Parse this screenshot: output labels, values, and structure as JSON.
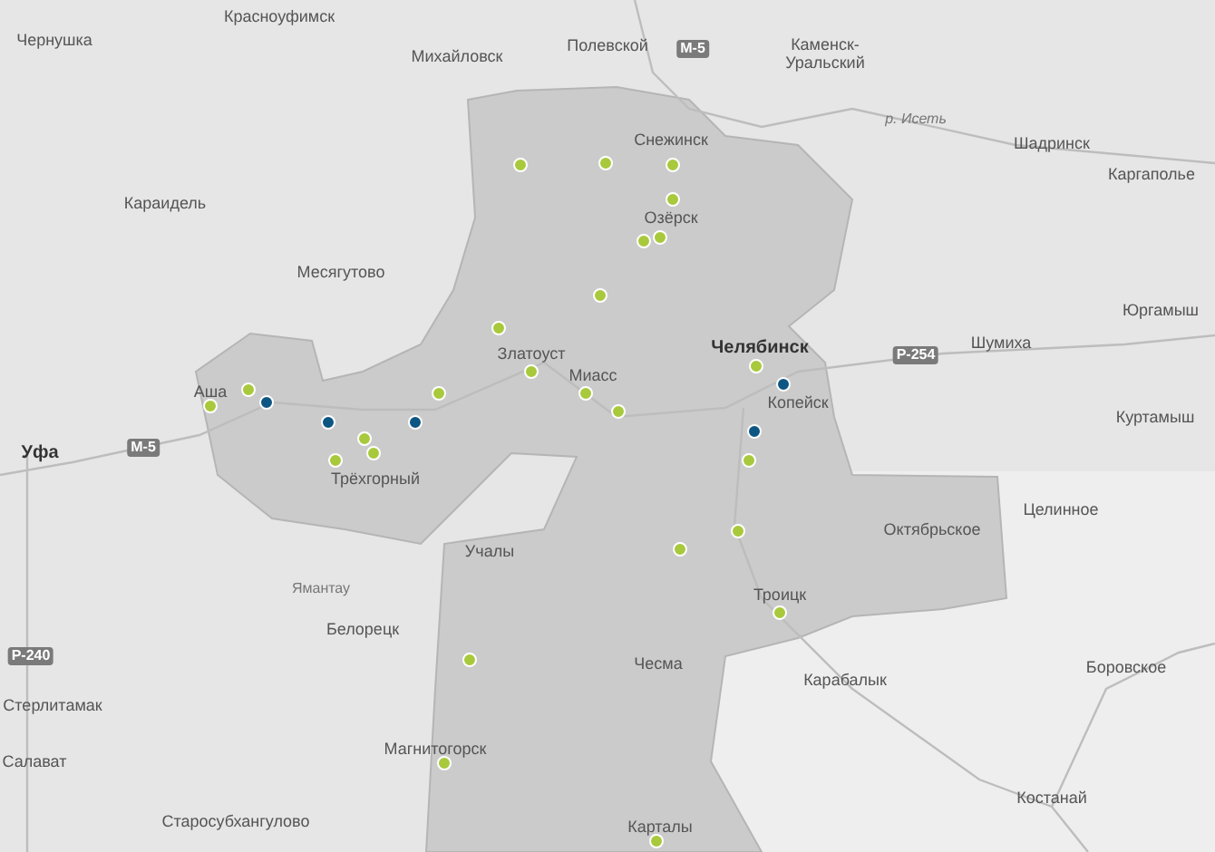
{
  "places": [
    {
      "label": "Красноуфимск",
      "kind": "town"
    },
    {
      "label": "Чернушка",
      "kind": "town"
    },
    {
      "label": "Михайловск",
      "kind": "town"
    },
    {
      "label": "Полевской",
      "kind": "town"
    },
    {
      "label": "М-5",
      "kind": "road"
    },
    {
      "label": "Каменск-Уральский",
      "kind": "town"
    },
    {
      "label": "р. Исеть",
      "kind": "river"
    },
    {
      "label": "Снежинск",
      "kind": "town"
    },
    {
      "label": "Шадринск",
      "kind": "town"
    },
    {
      "label": "Каргаполье",
      "kind": "town"
    },
    {
      "label": "Караидель",
      "kind": "town"
    },
    {
      "label": "Озёрск",
      "kind": "town"
    },
    {
      "label": "Месягутово",
      "kind": "town"
    },
    {
      "label": "Юргамыш",
      "kind": "town"
    },
    {
      "label": "Шумиха",
      "kind": "town"
    },
    {
      "label": "Златоуст",
      "kind": "town"
    },
    {
      "label": "Челябинск",
      "kind": "city"
    },
    {
      "label": "Р-254",
      "kind": "road"
    },
    {
      "label": "Миасс",
      "kind": "town"
    },
    {
      "label": "Аша",
      "kind": "town"
    },
    {
      "label": "Копейск",
      "kind": "town"
    },
    {
      "label": "Куртамыш",
      "kind": "town"
    },
    {
      "label": "М-5",
      "kind": "road"
    },
    {
      "label": "Уфа",
      "kind": "city"
    },
    {
      "label": "Трёхгорный",
      "kind": "town"
    },
    {
      "label": "Целинное",
      "kind": "town"
    },
    {
      "label": "Октябрьское",
      "kind": "town"
    },
    {
      "label": "Учалы",
      "kind": "town"
    },
    {
      "label": "Ямантау",
      "kind": "peak"
    },
    {
      "label": "Троицк",
      "kind": "town"
    },
    {
      "label": "Белорецк",
      "kind": "town"
    },
    {
      "label": "Р-240",
      "kind": "road"
    },
    {
      "label": "Чесма",
      "kind": "town"
    },
    {
      "label": "Боровское",
      "kind": "town"
    },
    {
      "label": "Карабалык",
      "kind": "town"
    },
    {
      "label": "Стерлитамак",
      "kind": "town"
    },
    {
      "label": "Магнитогорск",
      "kind": "town"
    },
    {
      "label": "Салават",
      "kind": "town"
    },
    {
      "label": "Костанай",
      "kind": "town"
    },
    {
      "label": "Старосубхангулово",
      "kind": "town"
    },
    {
      "label": "Карталы",
      "kind": "town"
    }
  ],
  "markers": [
    {
      "color": "#a8c93c"
    },
    {
      "color": "#a8c93c"
    },
    {
      "color": "#a8c93c"
    },
    {
      "color": "#a8c93c"
    },
    {
      "color": "#a8c93c"
    },
    {
      "color": "#a8c93c"
    },
    {
      "color": "#a8c93c"
    },
    {
      "color": "#a8c93c"
    },
    {
      "color": "#a8c93c"
    },
    {
      "color": "#a8c93c"
    },
    {
      "color": "#a8c93c"
    },
    {
      "color": "#a8c93c"
    },
    {
      "color": "#a8c93c"
    },
    {
      "color": "#a8c93c"
    },
    {
      "color": "#a8c93c"
    },
    {
      "color": "#a8c93c"
    },
    {
      "color": "#a8c93c"
    },
    {
      "color": "#a8c93c"
    },
    {
      "color": "#a8c93c"
    },
    {
      "color": "#a8c93c"
    },
    {
      "color": "#a8c93c"
    },
    {
      "color": "#a8c93c"
    },
    {
      "color": "#a8c93c"
    },
    {
      "color": "#a8c93c"
    },
    {
      "color": "#a8c93c"
    },
    {
      "color": "#0d5683"
    },
    {
      "color": "#0d5683"
    },
    {
      "color": "#0d5683"
    },
    {
      "color": "#0d5683"
    },
    {
      "color": "#0d5683"
    }
  ]
}
